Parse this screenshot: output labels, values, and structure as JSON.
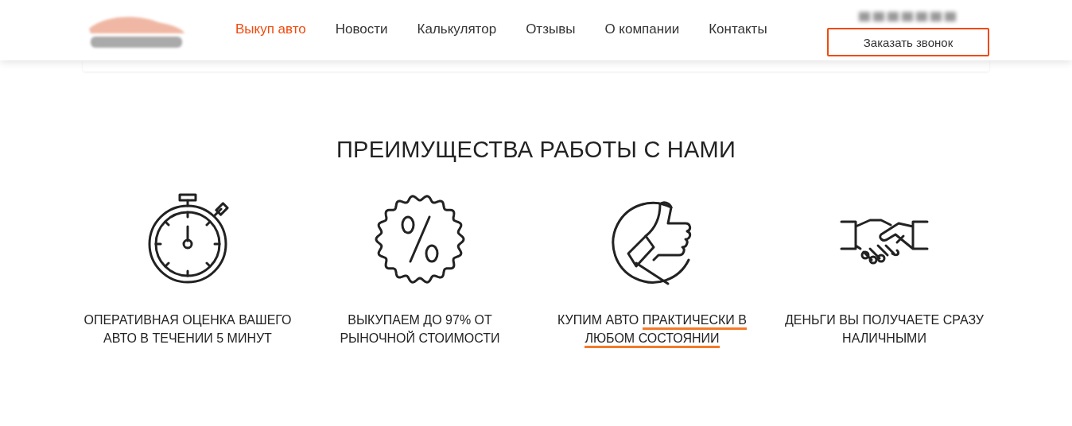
{
  "header": {
    "nav": [
      {
        "label": "Выкуп авто",
        "selected": true
      },
      {
        "label": "Новости",
        "selected": false
      },
      {
        "label": "Калькулятор",
        "selected": false
      },
      {
        "label": "Отзывы",
        "selected": false
      },
      {
        "label": "О компании",
        "selected": false
      },
      {
        "label": "Контакты",
        "selected": false
      }
    ],
    "callback_button": "Заказать звонок"
  },
  "advantages": {
    "title": "ПРЕИМУЩЕСТВА РАБОТЫ С НАМИ",
    "items": [
      {
        "kind": "stopwatch",
        "text": [
          {
            "t": "ОПЕРАТИВНАЯ ОЦЕНКА ВАШЕГО АВТО В ТЕЧЕНИИ 5 МИНУТ",
            "underlined": false
          }
        ]
      },
      {
        "kind": "percent",
        "text": [
          {
            "t": "ВЫКУПАЕМ ДО 97% ОТ РЫНОЧНОЙ СТОИМОСТИ",
            "underlined": false
          }
        ]
      },
      {
        "kind": "thumbsup",
        "text": [
          {
            "t": "КУПИМ АВТО ",
            "underlined": false
          },
          {
            "t": "ПРАКТИЧЕСКИ В ЛЮБОМ СОСТОЯНИИ",
            "underlined": true
          }
        ]
      },
      {
        "kind": "handshake",
        "text": [
          {
            "t": "ДЕНЬГИ ВЫ ПОЛУЧАЕТЕ СРАЗУ НАЛИЧНЫМИ",
            "underlined": false
          }
        ]
      }
    ]
  }
}
